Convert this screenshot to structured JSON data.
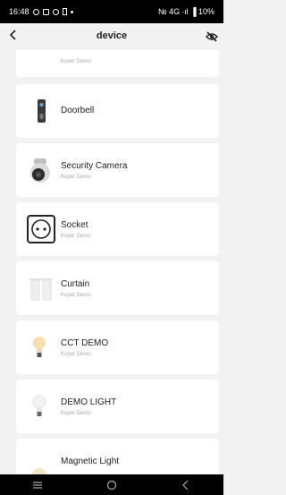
{
  "status": {
    "time": "16:48",
    "right": "№ 4G ∙ıl ▐ 10%"
  },
  "header": {
    "title": "device"
  },
  "devices": [
    {
      "name": "",
      "sub": "Koper Demo",
      "icon": "device-icon"
    },
    {
      "name": "Doorbell",
      "sub": "",
      "icon": "doorbell-icon"
    },
    {
      "name": "Security Camera",
      "sub": "Koper Demo",
      "icon": "camera-icon"
    },
    {
      "name": "Socket",
      "sub": "Koper Demo",
      "icon": "socket-icon"
    },
    {
      "name": "Curtain",
      "sub": "Koper Demo",
      "icon": "curtain-icon"
    },
    {
      "name": "CCT DEMO",
      "sub": "Koper Demo",
      "icon": "bulb-icon"
    },
    {
      "name": "DEMO LIGHT",
      "sub": "Koper Demo",
      "icon": "bulb-icon"
    },
    {
      "name": "Magnetic Light",
      "sub": "",
      "icon": "magnetic-light-icon"
    }
  ]
}
